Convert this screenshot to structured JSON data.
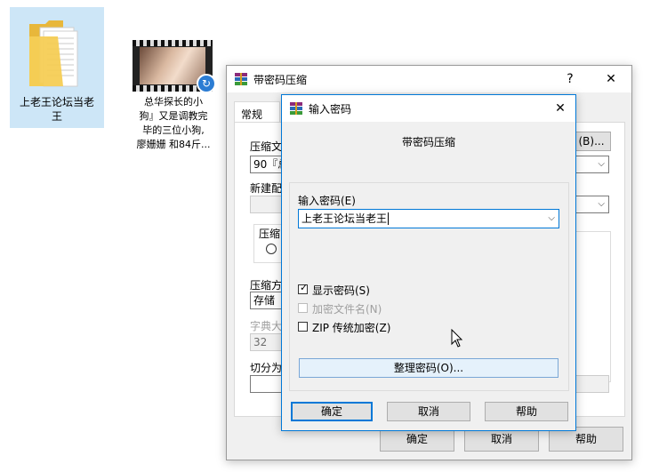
{
  "desktop": {
    "folder_label": "上老王论坛当老\n王",
    "video_label": "总华探长的小\n狗』又是调教完\n毕的三位小狗,\n廖姗姗 和84斤..."
  },
  "back_window": {
    "title": "带密码压缩",
    "help_btn": "?",
    "close_btn": "✕",
    "tab_general": "常规",
    "label_archive": "压缩文",
    "archive_value": "90『总",
    "browse_btn": "(B)...",
    "label_profile": "新建配",
    "label_format": "压缩",
    "label_method": "压缩方",
    "method_value": "存储",
    "label_dict": "字典大",
    "dict_value": "32",
    "label_split": "切分为",
    "ok_btn": "确定",
    "cancel_btn": "取消",
    "help_btn2": "帮助"
  },
  "dialog": {
    "title": "输入密码",
    "close_btn": "✕",
    "heading": "带密码压缩",
    "label_password": "输入密码(E)",
    "password_value": "上老王论坛当老王",
    "show_password": "显示密码(S)",
    "encrypt_names": "加密文件名(N)",
    "zip_legacy": "ZIP 传统加密(Z)",
    "organize_btn": "整理密码(O)...",
    "ok_btn": "确定",
    "cancel_btn": "取消",
    "help_btn": "帮助"
  }
}
